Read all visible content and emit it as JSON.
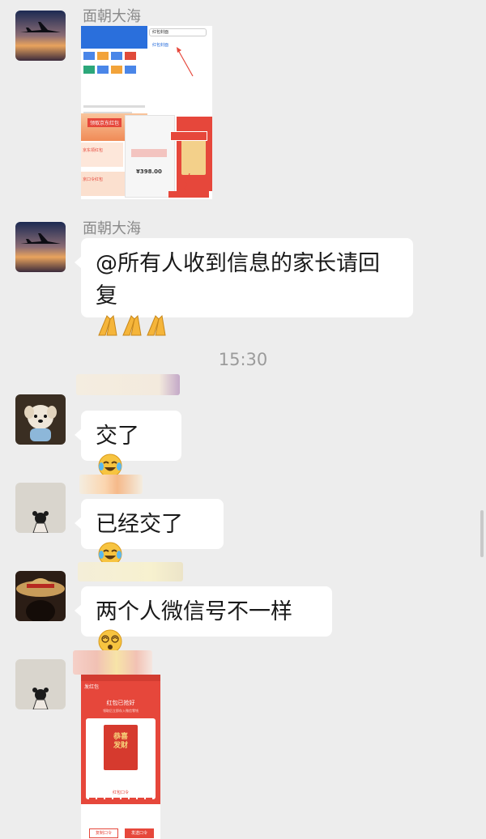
{
  "messages": [
    {
      "sender": "面朝大海",
      "type": "image"
    },
    {
      "sender": "面朝大海",
      "text": "@所有人收到信息的家长请回复"
    },
    {
      "text": "交了"
    },
    {
      "text": "已经交了"
    },
    {
      "text": "两个人微信号不一样"
    },
    {
      "type": "image"
    }
  ],
  "timestamp": "15:30",
  "screenshot1": {
    "search_text": "红包封面",
    "result_text": "红包封面",
    "price": "¥398.00",
    "banner1": "领取京东红包",
    "banner2": "京东领红包",
    "banner3": "京口令红包"
  },
  "screenshot2": {
    "back": "发红包",
    "header": "红包已抢好",
    "subheader": "领取后立即存入微信零钱",
    "card_line1": "恭喜",
    "card_line2": "发财",
    "code_label": "红包口令",
    "btn_left": "复制口令",
    "btn_right": "发送口令"
  },
  "colors": {
    "background": "#ededed",
    "bubble": "#ffffff",
    "red": "#e6473b",
    "name_gray": "#8a8a8a",
    "time_gray": "#9b9b9b"
  }
}
